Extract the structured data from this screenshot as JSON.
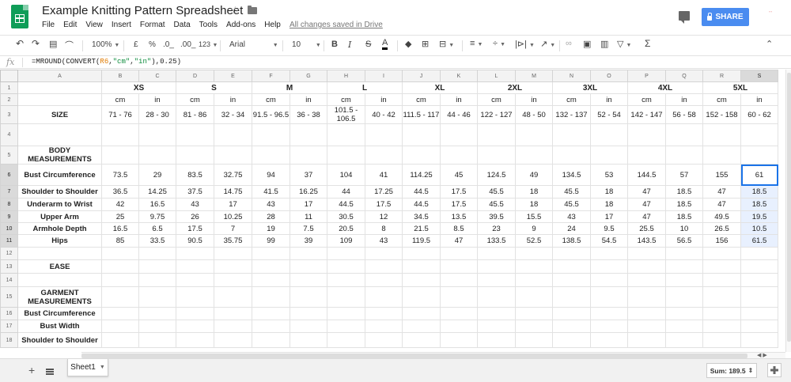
{
  "header": {
    "title": "Example Knitting Pattern Spreadsheet",
    "menu": [
      "File",
      "Edit",
      "View",
      "Insert",
      "Format",
      "Data",
      "Tools",
      "Add-ons",
      "Help"
    ],
    "saved_status": "All changes saved in Drive",
    "share_label": "SHARE",
    "brand_color": "#0f9d58",
    "share_color": "#4a8cf0"
  },
  "toolbar": {
    "zoom": "100%",
    "currency": "£",
    "percent": "%",
    "decrease_decimals": ".0_",
    "increase_decimals": ".00_",
    "more_formats": "123",
    "font": "Arial",
    "font_size": "10",
    "bold": "B",
    "italic": "I",
    "strike": "S",
    "text_color": "A",
    "functions": "Σ"
  },
  "formula_bar": {
    "fx": "fx",
    "formula_prefix": "=MROUND(CONVERT(",
    "formula_ref": "R6",
    "formula_mid1": ",",
    "formula_str1": "\"cm\"",
    "formula_mid2": ",",
    "formula_str2": "\"in\"",
    "formula_suffix": "),0.25)"
  },
  "grid": {
    "columns": [
      "A",
      "B",
      "C",
      "D",
      "E",
      "F",
      "G",
      "H",
      "I",
      "J",
      "K",
      "L",
      "M",
      "N",
      "O",
      "P",
      "Q",
      "R",
      "S"
    ],
    "rows": [
      "1",
      "2",
      "3",
      "4",
      "5",
      "6",
      "7",
      "8",
      "9",
      "10",
      "11",
      "12",
      "13",
      "14",
      "15",
      "16",
      "17",
      "18"
    ],
    "sizes": [
      "XS",
      "S",
      "M",
      "L",
      "XL",
      "2XL",
      "3XL",
      "4XL",
      "5XL"
    ],
    "units": [
      "cm",
      "in",
      "cm",
      "in",
      "cm",
      "in",
      "cm",
      "in",
      "cm",
      "in",
      "cm",
      "in",
      "cm",
      "in",
      "cm",
      "in",
      "cm",
      "in"
    ],
    "size_label": "SIZE",
    "size_values": [
      "71 - 76",
      "28 - 30",
      "81 - 86",
      "32 - 34",
      "91.5 - 96.5",
      "36 - 38",
      "101.5 - 106.5",
      "40 - 42",
      "111.5 - 117",
      "44 - 46",
      "122 - 127",
      "48 - 50",
      "132 - 137",
      "52 - 54",
      "142 - 147",
      "56 - 58",
      "152 - 158",
      "60 - 62"
    ],
    "body_measurements_label": "BODY MEASUREMENTS",
    "measurement_rows": [
      {
        "label": "Bust Circumference",
        "values": [
          "73.5",
          "29",
          "83.5",
          "32.75",
          "94",
          "37",
          "104",
          "41",
          "114.25",
          "45",
          "124.5",
          "49",
          "134.5",
          "53",
          "144.5",
          "57",
          "155",
          "61"
        ]
      },
      {
        "label": "Shoulder to Shoulder",
        "values": [
          "36.5",
          "14.25",
          "37.5",
          "14.75",
          "41.5",
          "16.25",
          "44",
          "17.25",
          "44.5",
          "17.5",
          "45.5",
          "18",
          "45.5",
          "18",
          "47",
          "18.5",
          "47",
          "18.5"
        ]
      },
      {
        "label": "Underarm to Wrist",
        "values": [
          "42",
          "16.5",
          "43",
          "17",
          "43",
          "17",
          "44.5",
          "17.5",
          "44.5",
          "17.5",
          "45.5",
          "18",
          "45.5",
          "18",
          "47",
          "18.5",
          "47",
          "18.5"
        ]
      },
      {
        "label": "Upper Arm",
        "values": [
          "25",
          "9.75",
          "26",
          "10.25",
          "28",
          "11",
          "30.5",
          "12",
          "34.5",
          "13.5",
          "39.5",
          "15.5",
          "43",
          "17",
          "47",
          "18.5",
          "49.5",
          "19.5"
        ]
      },
      {
        "label": "Armhole Depth",
        "values": [
          "16.5",
          "6.5",
          "17.5",
          "7",
          "19",
          "7.5",
          "20.5",
          "8",
          "21.5",
          "8.5",
          "23",
          "9",
          "24",
          "9.5",
          "25.5",
          "10",
          "26.5",
          "10.5"
        ]
      },
      {
        "label": "Hips",
        "values": [
          "85",
          "33.5",
          "90.5",
          "35.75",
          "99",
          "39",
          "109",
          "43",
          "119.5",
          "47",
          "133.5",
          "52.5",
          "138.5",
          "54.5",
          "143.5",
          "56.5",
          "156",
          "61.5"
        ]
      }
    ],
    "ease_label": "EASE",
    "garment_measurements_label": "GARMENT MEASUREMENTS",
    "garment_rows": [
      "Bust Circumference",
      "Bust Width",
      "Shoulder to Shoulder"
    ],
    "selection_color": "#1a73e8"
  },
  "bottom": {
    "sheet_name": "Sheet1",
    "sum_label": "Sum: 189.5"
  }
}
